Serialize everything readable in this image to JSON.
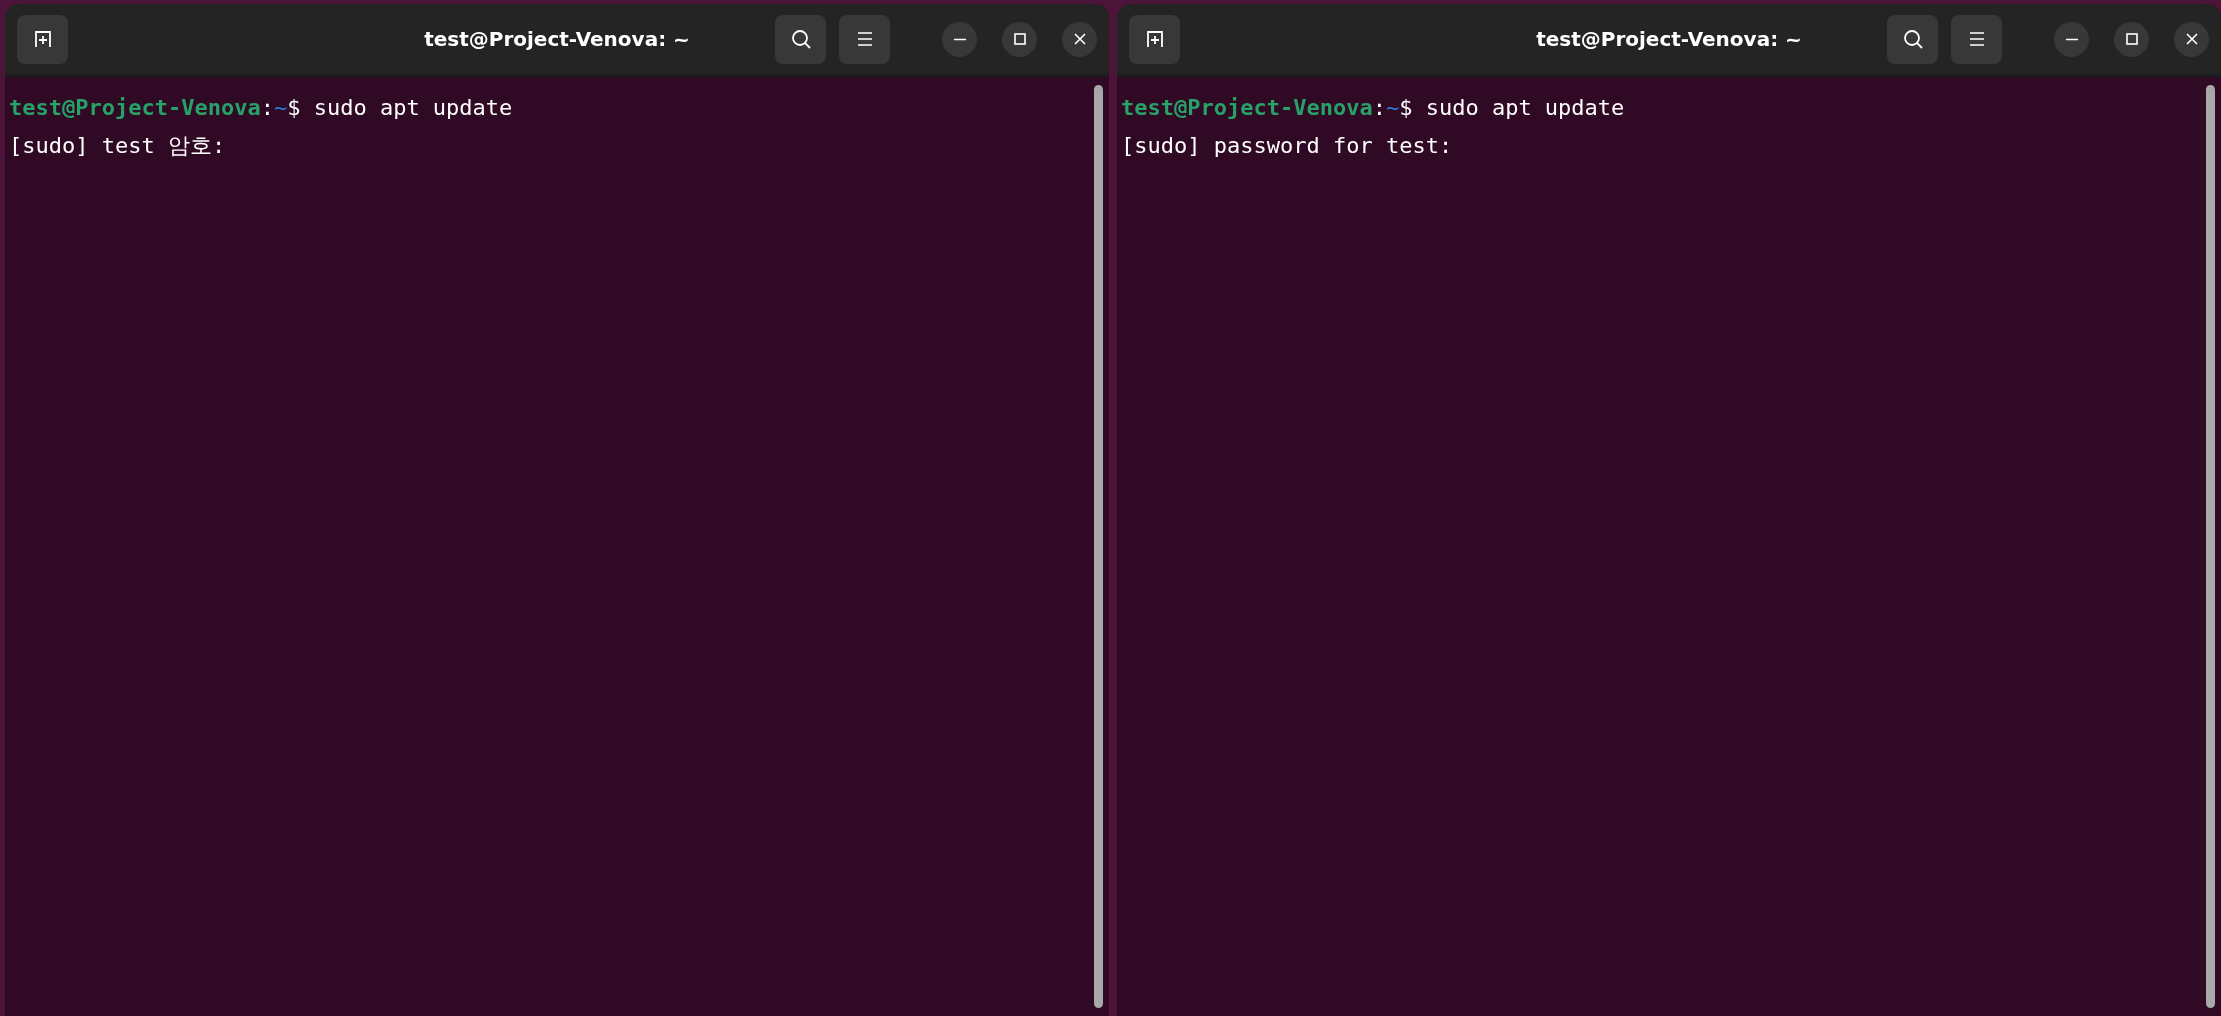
{
  "windows": [
    {
      "title": "test@Project-Venova: ~",
      "lines": [
        [
          {
            "kind": "userhost",
            "text": "test@Project-Venova"
          },
          {
            "kind": "plain",
            "text": ":"
          },
          {
            "kind": "path",
            "text": "~"
          },
          {
            "kind": "plain",
            "text": "$ sudo apt update"
          }
        ],
        [
          {
            "kind": "plain",
            "text": "[sudo] test 암호:"
          }
        ]
      ]
    },
    {
      "title": "test@Project-Venova: ~",
      "lines": [
        [
          {
            "kind": "userhost",
            "text": "test@Project-Venova"
          },
          {
            "kind": "plain",
            "text": ":"
          },
          {
            "kind": "path",
            "text": "~"
          },
          {
            "kind": "plain",
            "text": "$ sudo apt update"
          }
        ],
        [
          {
            "kind": "plain",
            "text": "[sudo] password for test:"
          }
        ]
      ]
    }
  ]
}
